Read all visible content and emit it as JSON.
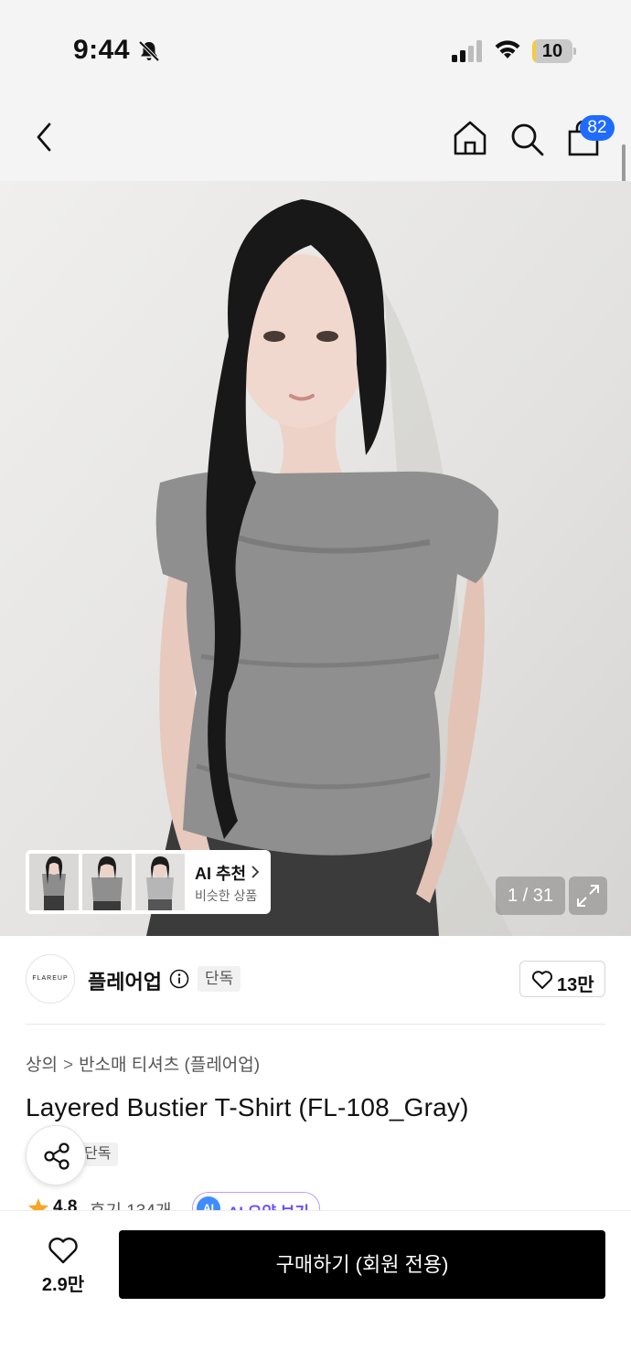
{
  "status_bar": {
    "time": "9:44",
    "battery_level": "10",
    "battery_fraction": 0.1
  },
  "nav": {
    "cart_count": "82"
  },
  "gallery": {
    "page_indicator": "1 / 31",
    "ai_recommend": {
      "title": "AI 추천",
      "subtitle": "비슷한 상품"
    }
  },
  "brand": {
    "logo_text": "FLAREUP",
    "name": "플레어업",
    "badge": "단독",
    "likes": "13만"
  },
  "product": {
    "breadcrumb": [
      "상의",
      "반소매 티셔츠 (플레어업)"
    ],
    "breadcrumb_separator": ">",
    "title": "Layered Bustier T-Shirt (FL-108_Gray)",
    "badge": "단독",
    "rating": "4.8",
    "reviews": "후기 134개",
    "ai_summary_icon": "AI",
    "ai_summary_label": "AI 요약 보기"
  },
  "bottom_bar": {
    "wish_count": "2.9만",
    "buy_label": "구매하기 (회원 전용)"
  },
  "colors": {
    "accent_badge": "#1f6bff",
    "battery_fill": "#f5cc3a",
    "buy_button": "#000000",
    "rating_star": "#f5a623",
    "ai_summary_border": "#b99cff"
  },
  "icons": [
    "bell-slash-icon",
    "signal-icon",
    "wifi-icon",
    "back-icon",
    "home-icon",
    "search-icon",
    "shopping-bag-icon",
    "chevron-right-icon",
    "expand-icon",
    "info-icon",
    "heart-icon",
    "share-icon",
    "star-icon"
  ]
}
